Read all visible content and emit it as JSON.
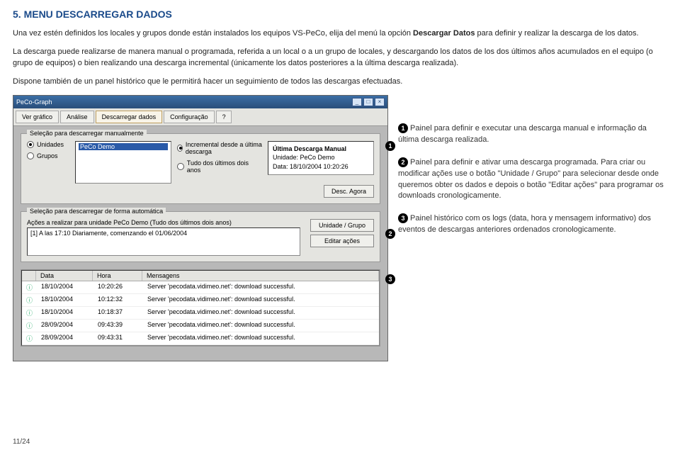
{
  "title": "5. MENU DESCARREGAR DADOS",
  "intro_1a": "Una vez estén definidos los locales y grupos donde están instalados los equipos VS-PeCo, elija del menú la opción ",
  "intro_1b": "Descargar Datos",
  "intro_1c": " para definir y realizar la descarga de los datos.",
  "intro_2": "La descarga puede realizarse de manera manual o programada, referida a un local o a un grupo de locales, y descargando los datos de los dos últimos años acumulados en el equipo (o grupo de equipos) o bien realizando una descarga incremental (únicamente los datos posteriores a la última descarga realizada).",
  "intro_3": "Dispone también de un panel histórico que le permitirá hacer un seguimiento de todos las descargas efectuadas.",
  "window": {
    "title": "PeCo-Graph",
    "toolbar": {
      "t1": "Ver gráfico",
      "t2": "Análise",
      "t3": "Descarregar dados",
      "t4": "Configuração",
      "help": "?"
    },
    "panel1": {
      "header": "Seleção para descarregar manualmente",
      "radio_unidades": "Unidades",
      "radio_grupos": "Grupos",
      "list_item": "PeCo Demo",
      "radio_incremental": "Incremental desde a última descarga",
      "radio_tudo": "Tudo dos últimos dois anos",
      "info_title": "Última Descarga Manual",
      "info_unidade": "Unidade: PeCo Demo",
      "info_data": "Data: 18/10/2004 10:20:26",
      "btn_desc": "Desc. Agora"
    },
    "panel2": {
      "header": "Seleção para descarregar de forma automática",
      "sub": "Ações a realizar para unidade PeCo Demo (Tudo dos últimos dois anos)",
      "action_line": "[1] A las 17:10 Diariamente, comenzando el 01/06/2004",
      "btn_grp": "Unidade / Grupo",
      "btn_edit": "Editar ações"
    },
    "panel3": {
      "col_data": "Data",
      "col_hora": "Hora",
      "col_msg": "Mensagens",
      "rows": [
        {
          "d": "18/10/2004",
          "h": "10:20:26",
          "m": "Server 'pecodata.vidimeo.net': download successful."
        },
        {
          "d": "18/10/2004",
          "h": "10:12:32",
          "m": "Server 'pecodata.vidimeo.net': download successful."
        },
        {
          "d": "18/10/2004",
          "h": "10:18:37",
          "m": "Server 'pecodata.vidimeo.net': download successful."
        },
        {
          "d": "28/09/2004",
          "h": "09:43:39",
          "m": "Server 'pecodata.vidimeo.net': download successful."
        },
        {
          "d": "28/09/2004",
          "h": "09:43:31",
          "m": "Server 'pecodata.vidimeo.net': download successful."
        }
      ]
    }
  },
  "markers": {
    "m1": "1",
    "m2": "2",
    "m3": "3"
  },
  "side": {
    "b1_n": "1",
    "b1": " Painel para definir e executar una descarga manual e informação da última descarga realizada.",
    "b2_n": "2",
    "b2": " Painel para definir e ativar uma descarga programada. Para criar ou modificar ações use o botão \"Unidade / Grupo\" para selecionar desde onde queremos obter os dados e depois o botão \"Editar ações\" para programar os downloads cronologicamente.",
    "b3_n": "3",
    "b3": " Painel histórico com os logs (data, hora y mensagem informativo) dos eventos de descargas anteriores ordenados cronologicamente."
  },
  "page_num": "11/24"
}
